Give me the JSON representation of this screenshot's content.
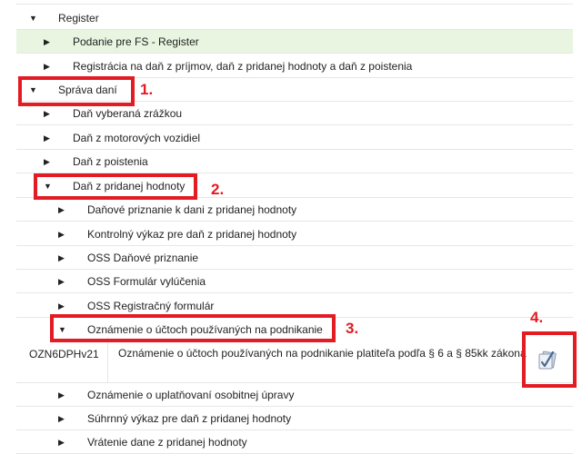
{
  "tree": {
    "top_cut_label": "",
    "items": [
      {
        "label": "Register",
        "state": "expanded"
      },
      {
        "label": "Podanie pre FS - Register",
        "state": "collapsed"
      },
      {
        "label": "Registrácia na daň z príjmov, daň z pridanej hodnoty a daň z poistenia",
        "state": "collapsed"
      },
      {
        "label": "Správa daní",
        "state": "expanded"
      },
      {
        "label": "Daň vyberaná zrážkou",
        "state": "collapsed"
      },
      {
        "label": "Daň z motorových vozidiel",
        "state": "collapsed"
      },
      {
        "label": "Daň z poistenia",
        "state": "collapsed"
      },
      {
        "label": "Daň z pridanej hodnoty",
        "state": "expanded"
      },
      {
        "label": "Daňové priznanie k dani z pridanej hodnoty",
        "state": "collapsed"
      },
      {
        "label": "Kontrolný výkaz pre daň z pridanej hodnoty",
        "state": "collapsed"
      },
      {
        "label": "OSS Daňové priznanie",
        "state": "collapsed"
      },
      {
        "label": "OSS Formulár vylúčenia",
        "state": "collapsed"
      },
      {
        "label": "OSS Registračný formulár",
        "state": "collapsed"
      },
      {
        "label": "Oznámenie o účtoch používaných na podnikanie",
        "state": "expanded"
      },
      {
        "label": "Oznámenie o uplatňovaní osobitnej úpravy",
        "state": "collapsed"
      },
      {
        "label": "Súhrnný výkaz pre daň z pridanej hodnoty",
        "state": "collapsed"
      },
      {
        "label": "Vrátenie dane z pridanej hodnoty",
        "state": "collapsed"
      }
    ],
    "document": {
      "code": "OZN6DPHv21",
      "description": "Oznámenie o účtoch používaných na podnikanie platiteľa podľa § 6 a § 85kk zákona"
    }
  },
  "annotations": {
    "step1": "1.",
    "step2": "2.",
    "step3": "3.",
    "step4": "4.",
    "color": "#e31b23"
  },
  "icons": {
    "expanded": "▼",
    "collapsed": "▶",
    "sign": "sign-document-icon"
  },
  "colors": {
    "highlight_row": "#e9f5e1",
    "divider": "#e6e6e6"
  }
}
